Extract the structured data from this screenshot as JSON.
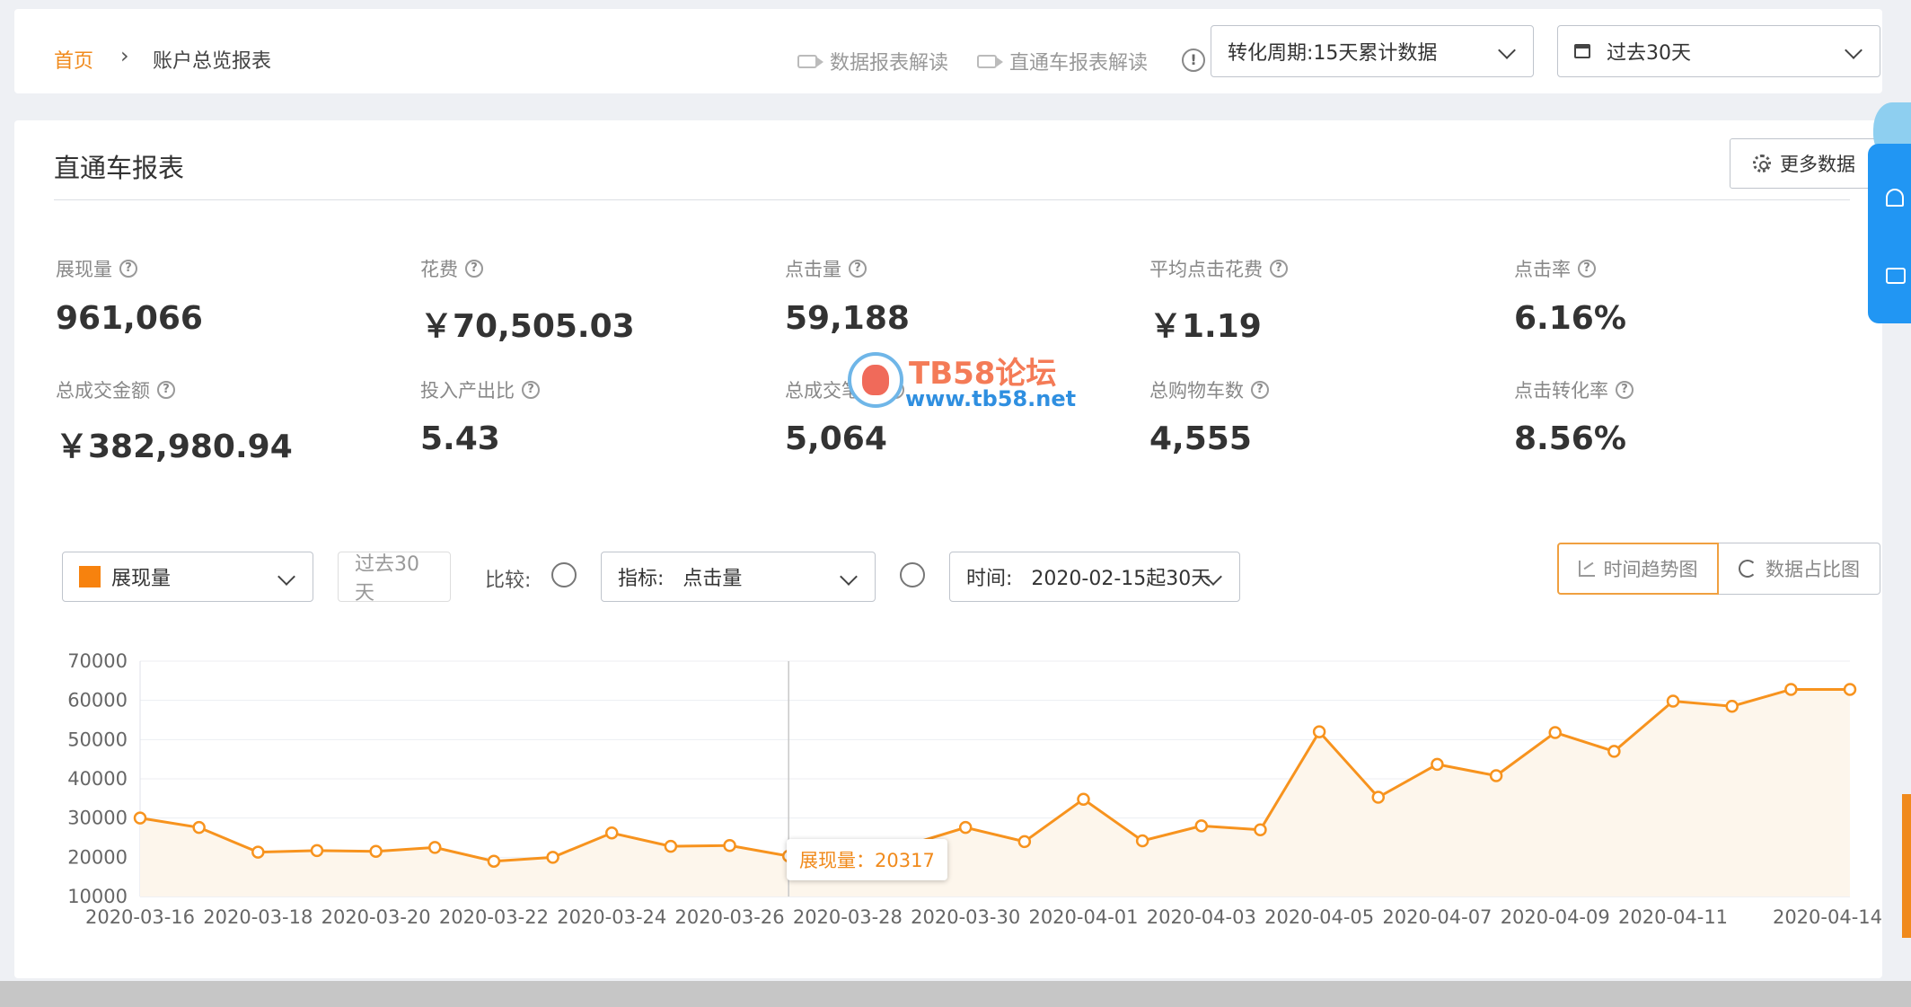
{
  "breadcrumb": {
    "home": "首页",
    "separator": "›",
    "current": "账户总览报表"
  },
  "header": {
    "links": [
      "数据报表解读",
      "直通车报表解读"
    ],
    "info_icon": "!",
    "conversion_period": "转化周期:15天累计数据",
    "date_range": "过去30天"
  },
  "panel": {
    "title": "直通车报表",
    "more_button": "更多数据"
  },
  "metrics": [
    {
      "label": "展现量",
      "value": "961,066"
    },
    {
      "label": "花费",
      "value": "￥70,505.03"
    },
    {
      "label": "点击量",
      "value": "59,188"
    },
    {
      "label": "平均点击花费",
      "value": "￥1.19"
    },
    {
      "label": "点击率",
      "value": "6.16%"
    },
    {
      "label": "总成交金额",
      "value": "￥382,980.94"
    },
    {
      "label": "投入产出比",
      "value": "5.43"
    },
    {
      "label": "总成交笔数",
      "value": "5,064"
    },
    {
      "label": "总购物车数",
      "value": "4,555"
    },
    {
      "label": "点击转化率",
      "value": "8.56%"
    }
  ],
  "help_glyph": "?",
  "watermark": {
    "title": "TB58论坛",
    "url": "www.tb58.net"
  },
  "controls": {
    "metric_select": "展现量",
    "range_button": "过去30天",
    "compare_label": "比较:",
    "indicator_select": "指标:   点击量",
    "time_select": "时间:   2020-02-15起30天",
    "view_trend": "时间趋势图",
    "view_share": "数据占比图"
  },
  "colors": {
    "accent": "#f7931e",
    "brand_orange": "#f08a1c",
    "side_widget": "#2196f3"
  },
  "tooltip": {
    "label": "展现量：20317"
  },
  "chart_data": {
    "type": "line",
    "series": [
      {
        "name": "展现量",
        "x": [
          "2020-03-16",
          "2020-03-17",
          "2020-03-18",
          "2020-03-19",
          "2020-03-20",
          "2020-03-21",
          "2020-03-22",
          "2020-03-23",
          "2020-03-24",
          "2020-03-25",
          "2020-03-26",
          "2020-03-27",
          "2020-03-28",
          "2020-03-29",
          "2020-03-30",
          "2020-03-31",
          "2020-04-01",
          "2020-04-02",
          "2020-04-03",
          "2020-04-04",
          "2020-04-05",
          "2020-04-06",
          "2020-04-07",
          "2020-04-08",
          "2020-04-09",
          "2020-04-10",
          "2020-04-11",
          "2020-04-12",
          "2020-04-13",
          "2020-04-14"
        ],
        "values": [
          30000,
          27600,
          21300,
          21700,
          21500,
          22500,
          19000,
          20000,
          26200,
          22800,
          23000,
          20317,
          23000,
          23000,
          27600,
          24000,
          34800,
          24200,
          28000,
          27000,
          52000,
          35300,
          43700,
          40800,
          51800,
          47000,
          59800,
          58500,
          62800,
          62800
        ]
      }
    ],
    "xticks": [
      "2020-03-16",
      "2020-03-18",
      "2020-03-20",
      "2020-03-22",
      "2020-03-24",
      "2020-03-26",
      "2020-03-28",
      "2020-03-30",
      "2020-04-01",
      "2020-04-03",
      "2020-04-05",
      "2020-04-07",
      "2020-04-09",
      "2020-04-11",
      "2020-04-14"
    ],
    "yticks": [
      10000,
      20000,
      30000,
      40000,
      50000,
      60000,
      70000
    ],
    "ylim": [
      10000,
      70000
    ],
    "grid": true,
    "highlight_index": 11
  }
}
